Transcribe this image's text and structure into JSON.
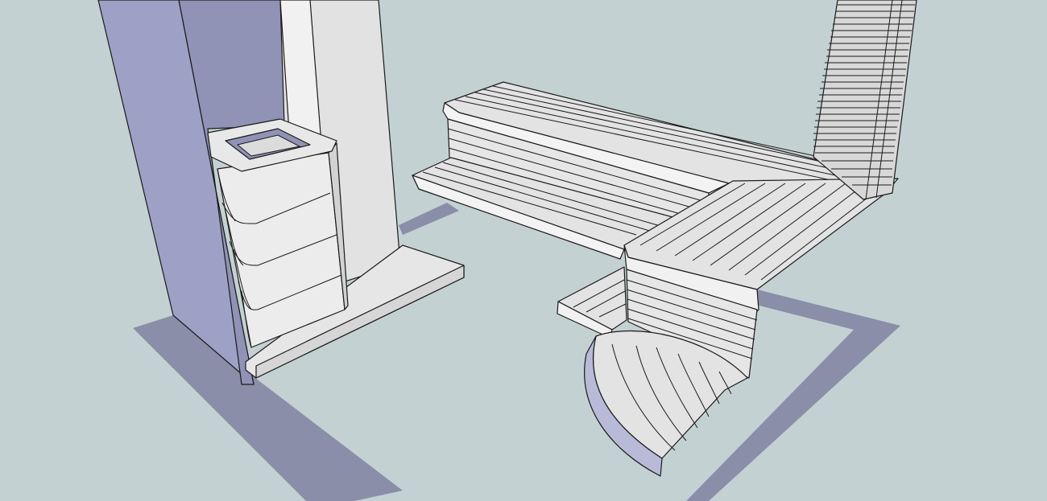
{
  "viewport": {
    "background": "#c4d1d3",
    "model": "sauna-interior-3d-model"
  },
  "colors": {
    "floor_shadow": "#8b8ea8",
    "wall_shade": "#9a9dc2",
    "wall_dark": "#8f93b4",
    "light_face": "#ececec",
    "mid_face": "#dcdcdc",
    "plank_face": "#e3e3e3",
    "edge_line": "#1a1a1a",
    "curved_rim": "#b8bad8"
  }
}
